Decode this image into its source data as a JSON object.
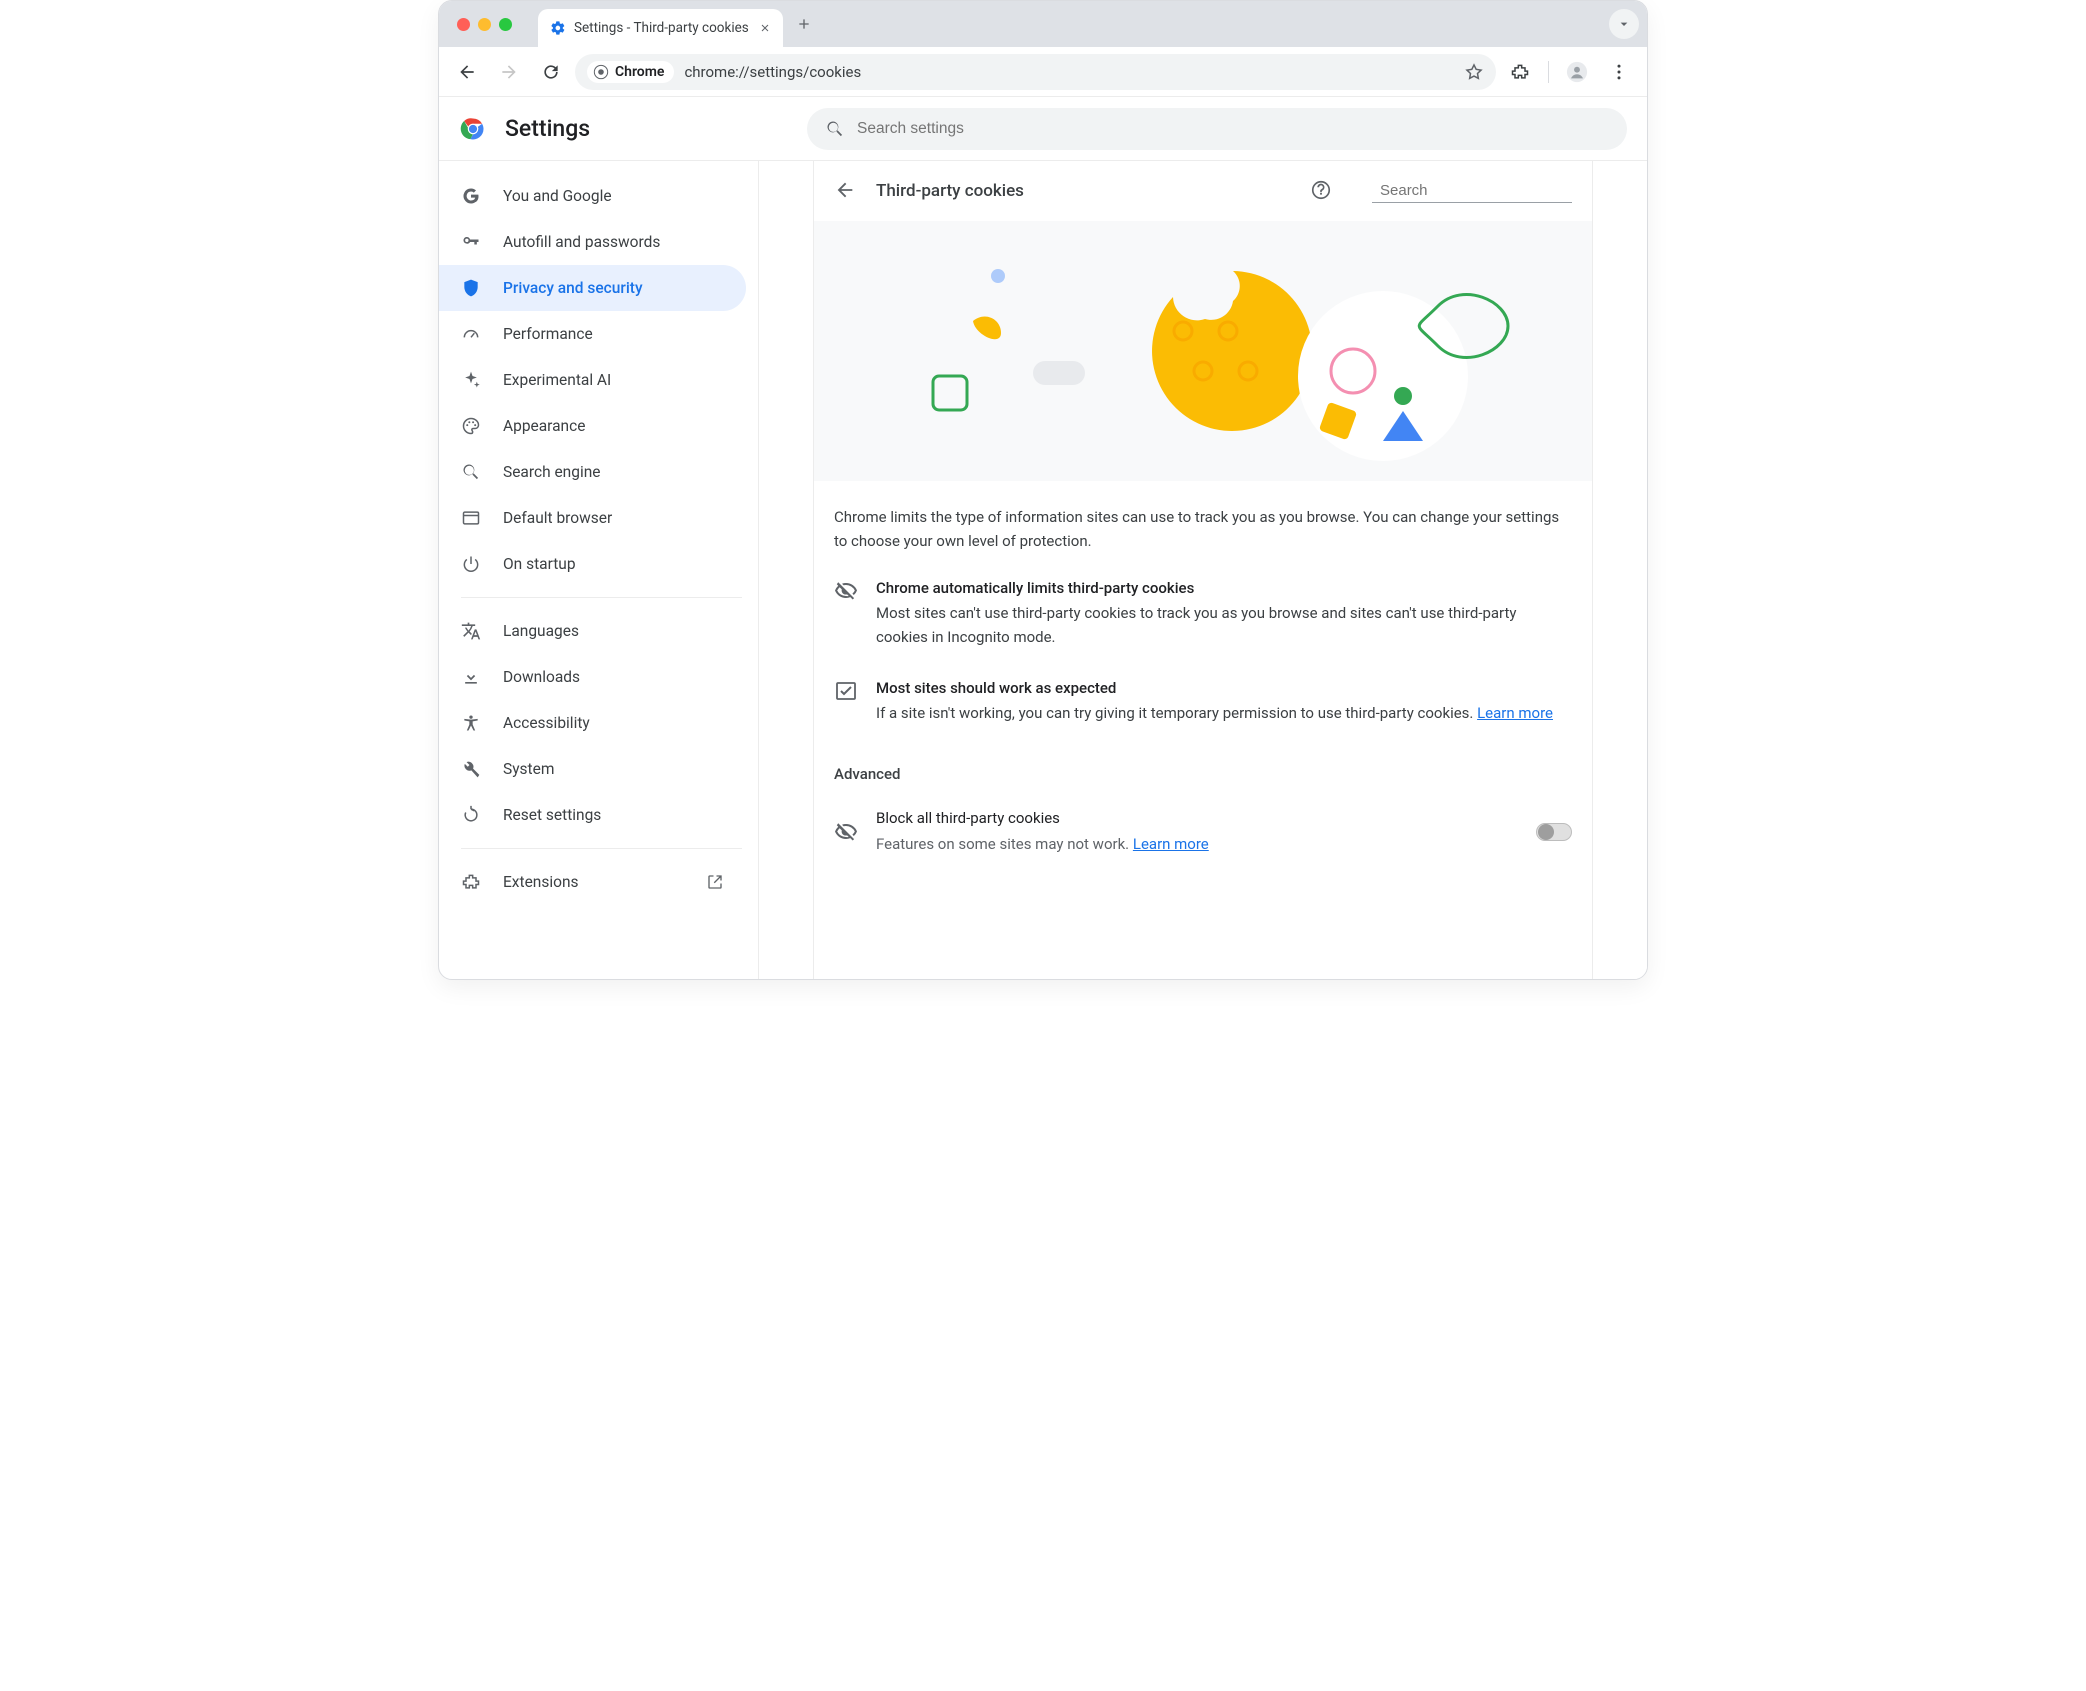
{
  "browser": {
    "tab_title": "Settings - Third-party cookies",
    "omnibox_chip": "Chrome",
    "omnibox_url": "chrome://settings/cookies"
  },
  "app": {
    "title": "Settings",
    "search_placeholder": "Search settings"
  },
  "sidebar": {
    "items": [
      {
        "label": "You and Google"
      },
      {
        "label": "Autofill and passwords"
      },
      {
        "label": "Privacy and security"
      },
      {
        "label": "Performance"
      },
      {
        "label": "Experimental AI"
      },
      {
        "label": "Appearance"
      },
      {
        "label": "Search engine"
      },
      {
        "label": "Default browser"
      },
      {
        "label": "On startup"
      }
    ],
    "items2": [
      {
        "label": "Languages"
      },
      {
        "label": "Downloads"
      },
      {
        "label": "Accessibility"
      },
      {
        "label": "System"
      },
      {
        "label": "Reset settings"
      }
    ],
    "items3": [
      {
        "label": "Extensions"
      }
    ]
  },
  "page": {
    "title": "Third-party cookies",
    "search_placeholder": "Search",
    "intro": "Chrome limits the type of information sites can use to track you as you browse. You can change your settings to choose your own level of protection.",
    "info1": {
      "title": "Chrome automatically limits third-party cookies",
      "body": "Most sites can't use third-party cookies to track you as you browse and sites can't use third-party cookies in Incognito mode."
    },
    "info2": {
      "title": "Most sites should work as expected",
      "body": "If a site isn't working, you can try giving it temporary permission to use third-party cookies. ",
      "link": "Learn more"
    },
    "advanced_label": "Advanced",
    "opt1": {
      "title": "Block all third-party cookies",
      "body": "Features on some sites may not work. ",
      "link": "Learn more"
    }
  }
}
